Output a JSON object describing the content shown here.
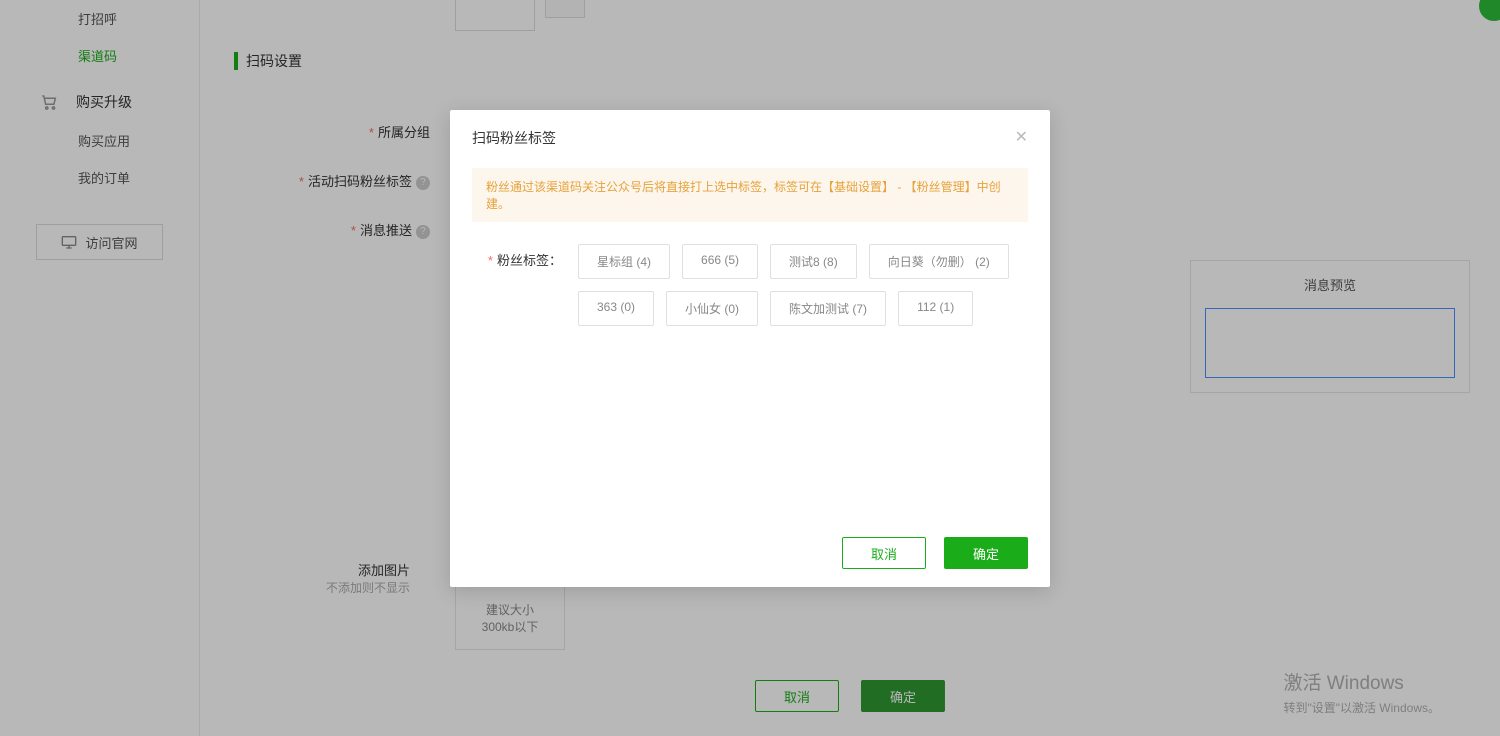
{
  "sidebar": {
    "items": [
      {
        "label": "打招呼"
      },
      {
        "label": "渠道码"
      }
    ],
    "purchase_group": "购买升级",
    "purchase_items": [
      {
        "label": "购买应用"
      },
      {
        "label": "我的订单"
      }
    ],
    "visit_site": "访问官网"
  },
  "section": {
    "title": "扫码设置",
    "group_label": "所属分组",
    "tag_label": "活动扫码粉丝标签",
    "push_label": "消息推送",
    "add_image": "添加图片",
    "add_image_hint": "不添加则不显示",
    "upload_hint_1": "建议大小",
    "upload_hint_2": "300kb以下"
  },
  "preview": {
    "title": "消息预览"
  },
  "main_actions": {
    "cancel": "取消",
    "confirm": "确定"
  },
  "modal": {
    "title": "扫码粉丝标签",
    "tip": "粉丝通过该渠道码关注公众号后将直接打上选中标签，标签可在【基础设置】 - 【粉丝管理】中创建。",
    "tag_field_label": "粉丝标签：",
    "tags": [
      "星标组 (4)",
      "666 (5)",
      "测试8 (8)",
      "向日葵（勿删） (2)",
      "363 (0)",
      "小仙女 (0)",
      "陈文加测试 (7)",
      "112 (1)"
    ],
    "cancel": "取消",
    "confirm": "确定"
  },
  "watermark": {
    "line1": "激活 Windows",
    "line2": "转到\"设置\"以激活 Windows。"
  }
}
